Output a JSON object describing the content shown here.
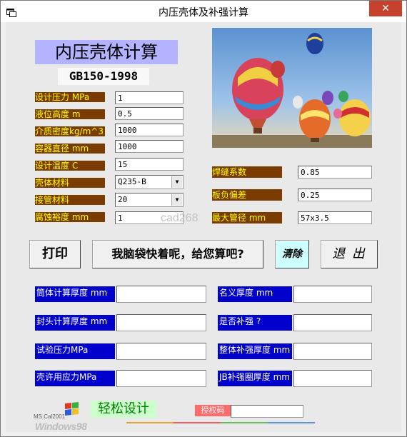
{
  "window": {
    "title": "内压壳体及补强计算",
    "close_glyph": "✕"
  },
  "header": {
    "heading": "内压壳体计算",
    "standard": "GB150-1998"
  },
  "inputs": {
    "design_pressure": {
      "label": "设计压力  MPa",
      "value": "1"
    },
    "liquid_height": {
      "label": "液位高度    m",
      "value": "0.5"
    },
    "medium_density": {
      "label": "介质密度kg/m^3",
      "value": "1000"
    },
    "vessel_diameter": {
      "label": "容器直径   mm",
      "value": "1000"
    },
    "design_temp": {
      "label": "设计温度   C",
      "value": "15"
    },
    "shell_material": {
      "label": "壳体材料",
      "value": "Q235-B"
    },
    "nozzle_material": {
      "label": "接管材料",
      "value": "20"
    },
    "corrosion_allowance": {
      "label": "腐蚀裕度   mm",
      "value": "1"
    },
    "weld_coefficient": {
      "label": "焊缝系数",
      "value": "0.85"
    },
    "plate_tolerance": {
      "label": "板负偏差",
      "value": "0.25"
    },
    "max_pipe_diameter": {
      "label": "最大管径 mm",
      "value": "57x3.5"
    }
  },
  "buttons": {
    "print": "打印",
    "calculate": "我脑袋快着呢，给您算吧?",
    "clear": "清除",
    "exit": "退 出"
  },
  "results": {
    "shell_thickness": "筒体计算厚度 mm",
    "head_thickness": "封头计算厚度 mm",
    "test_pressure": "试验压力MPa",
    "allowable_stress": "壳许用应力MPa",
    "nominal_thickness": "名义厚度 mm",
    "need_reinforce": "是否补强 ?",
    "integral_reinforce": "整体补强厚度 mm",
    "jb_ring_thickness": "JB补强圈厚度 mm"
  },
  "footer": {
    "easy_design": "轻松设计",
    "auth_code_label": "授权码",
    "logo_text": "Windows98",
    "logo_sub": "MS.Cal2001"
  },
  "watermark": "cad268",
  "colors": {
    "label_brown": "#7a3c00",
    "label_yellow_text": "#ffff00",
    "label_blue": "#0000cc",
    "heading_bg": "#b3b3ff",
    "clear_bg": "#ccffff",
    "easy_bg": "#ccffcc"
  }
}
